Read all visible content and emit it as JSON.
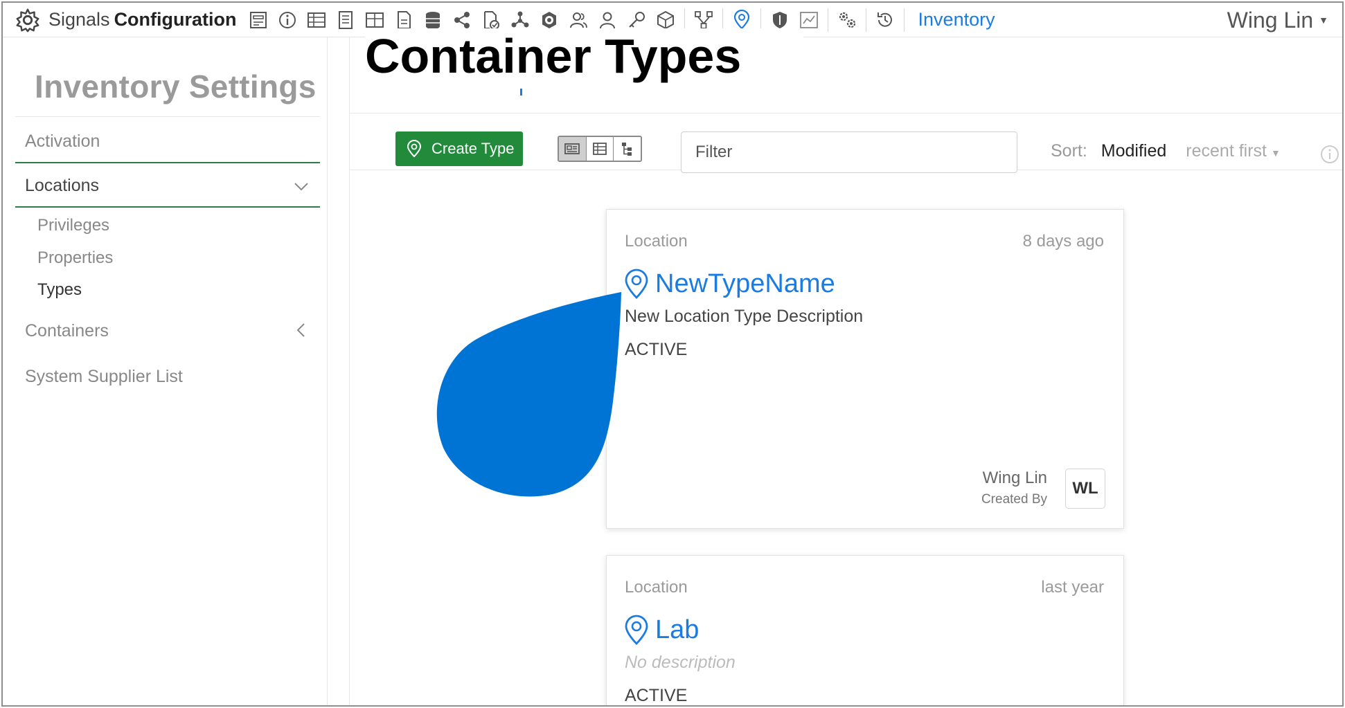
{
  "app": {
    "brand_light": "Signals",
    "brand_bold": "Configuration",
    "nav_active": "Inventory",
    "user_name": "Wing Lin"
  },
  "toolbar_icons": [
    "form-icon",
    "info-icon",
    "table-icon",
    "document-list-icon",
    "grid-icon",
    "file-icon",
    "database-icon",
    "share-icon",
    "file-check-icon",
    "network-icon",
    "chat-bubble-icon",
    "user-group-icon",
    "user-icon",
    "key-icon",
    "cube-icon",
    "workflow-icon",
    "location-pin-icon",
    "shield-icon",
    "chart-icon",
    "gears-icon",
    "history-icon"
  ],
  "sidebar": {
    "title": "Inventory Settings",
    "items": [
      {
        "label": "Activation"
      },
      {
        "label": "Locations",
        "expanded": true
      },
      {
        "label": "Containers",
        "expanded": false
      },
      {
        "label": "System Supplier List"
      }
    ],
    "location_subitems": [
      {
        "label": "Privileges"
      },
      {
        "label": "Properties"
      },
      {
        "label": "Types",
        "active": true
      }
    ]
  },
  "page": {
    "heading": "Container Types"
  },
  "toolbar": {
    "create_label": "Create Type",
    "filter_placeholder": "Filter",
    "sort_label": "Sort:",
    "sort_field": "Modified",
    "sort_order": "recent first"
  },
  "cards": [
    {
      "kind": "Location",
      "time": "8 days ago",
      "name": "NewTypeName",
      "description": "New Location Type Description",
      "status": "ACTIVE",
      "created_by_name": "Wing Lin",
      "created_by_label": "Created By",
      "avatar": "WL"
    },
    {
      "kind": "Location",
      "time": "last year",
      "name": "Lab",
      "description": "No description",
      "status": "ACTIVE"
    }
  ],
  "colors": {
    "accent": "#1a7be0",
    "create_button": "#228b3b",
    "sidebar_rule": "#2d7d46",
    "drop_shape": "#0074d4"
  }
}
